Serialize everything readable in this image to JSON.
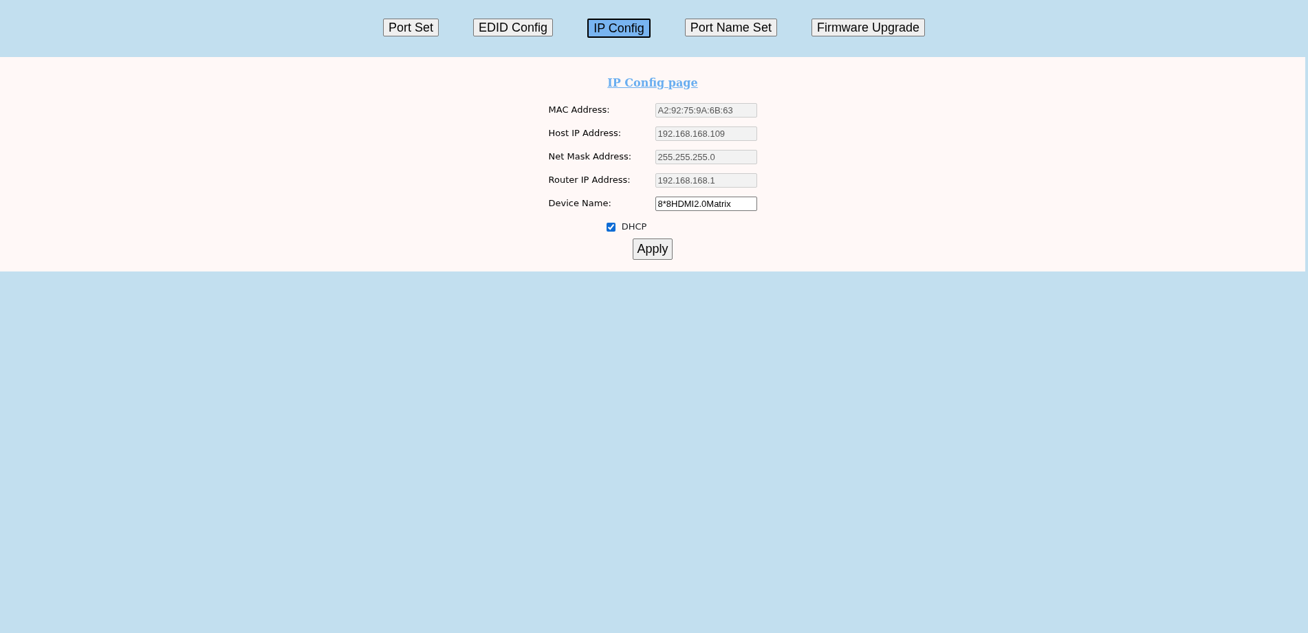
{
  "tabs": [
    {
      "label": "Port Set",
      "selected": false
    },
    {
      "label": "EDID Config",
      "selected": false
    },
    {
      "label": "IP Config",
      "selected": true
    },
    {
      "label": "Port Name Set",
      "selected": false
    },
    {
      "label": "Firmware Upgrade",
      "selected": false
    }
  ],
  "page_title": "IP Config page",
  "fields": [
    {
      "label": "MAC Address:",
      "value": "A2:92:75:9A:6B:63",
      "disabled": true
    },
    {
      "label": "Host IP Address:",
      "value": "192.168.168.109",
      "disabled": true
    },
    {
      "label": "Net Mask Address:",
      "value": "255.255.255.0",
      "disabled": true
    },
    {
      "label": "Router IP Address:",
      "value": "192.168.168.1",
      "disabled": true
    },
    {
      "label": "Device Name:",
      "value": "8*8HDMI2.0Matrix",
      "disabled": false
    }
  ],
  "dhcp": {
    "label": "DHCP",
    "checked": true
  },
  "apply_button": "Apply"
}
